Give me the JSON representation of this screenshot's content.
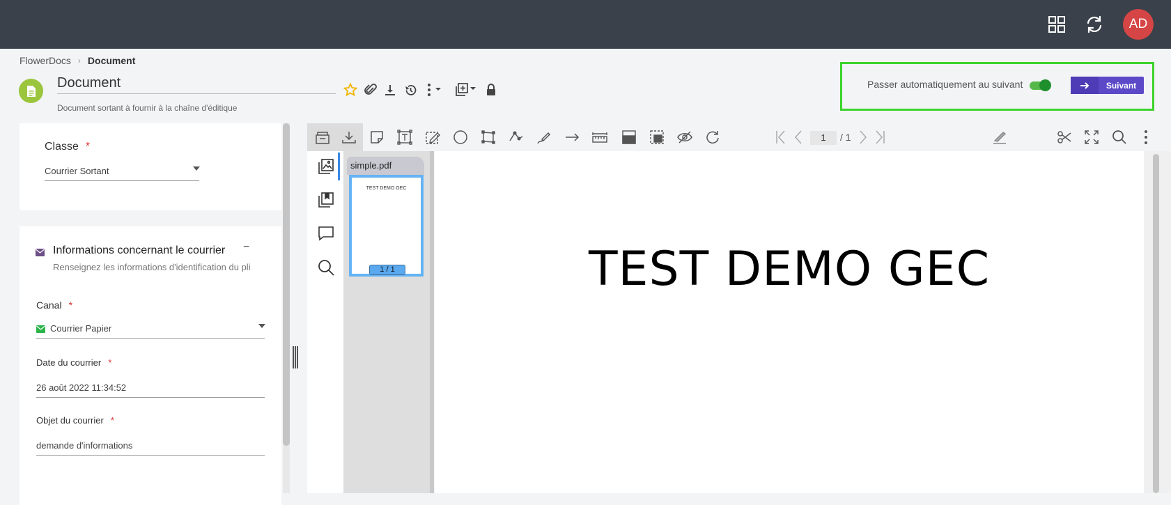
{
  "topbar": {
    "icons": [
      "grid-icon",
      "refresh-icon"
    ],
    "avatar_initials": "AD"
  },
  "breadcrumb": {
    "root": "FlowerDocs",
    "current": "Document"
  },
  "document": {
    "title": "Document",
    "subtitle": "Document sortant à fournir à la chaîne d'éditique",
    "actions": [
      "star-icon",
      "paperclip-icon",
      "download-icon",
      "history-icon",
      "more-menu-icon",
      "add-copy-icon",
      "lock-icon"
    ]
  },
  "auto_next": {
    "label": "Passer automatiquement au suivant",
    "enabled": true,
    "button_label": "Suivant"
  },
  "form": {
    "classe": {
      "label": "Classe",
      "required_mark": "*",
      "value": "Courrier Sortant"
    },
    "section": {
      "title": "Informations concernant le courrier",
      "description": "Renseignez les informations d'identification du pli",
      "collapse_symbol": "−"
    },
    "canal": {
      "label": "Canal",
      "required_mark": "*",
      "value": "Courrier Papier"
    },
    "date": {
      "label": "Date du courrier",
      "required_mark": "*",
      "value": "26 août 2022 11:34:52"
    },
    "objet": {
      "label": "Objet du courrier",
      "required_mark": "*",
      "value": "demande d'informations"
    }
  },
  "viewer": {
    "page_current": "1",
    "page_total": "/ 1",
    "file_name": "simple.pdf",
    "thumbnail_label": "1 / 1",
    "thumbnail_text": "TEST DEMO GEC",
    "page_text": "TEST DEMO GEC"
  },
  "colors": {
    "topbar": "#3a414b",
    "accent_green": "#3cd42c",
    "button_purple": "#5b49c8",
    "avatar_red": "#d64545"
  }
}
